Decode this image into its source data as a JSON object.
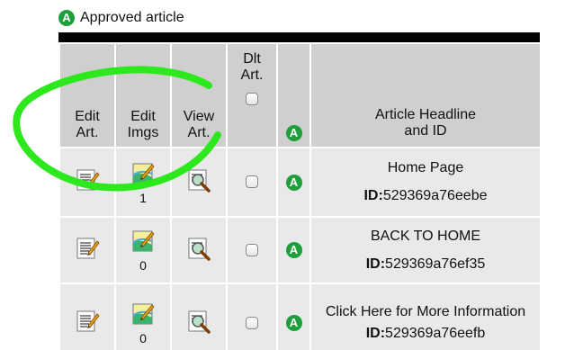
{
  "legend": {
    "badge_letter": "A",
    "label": "Approved article"
  },
  "table": {
    "headers": {
      "edit_article": "Edit\nArt.",
      "edit_images": "Edit\nImgs",
      "view_article": "View\nArt.",
      "delete_article": "Dlt\nArt.",
      "approved_badge": "A",
      "headline": "Article Headline\nand ID"
    },
    "rows": [
      {
        "image_count": "1",
        "approved_badge": "A",
        "headline": "Home Page",
        "id_label": "ID:",
        "id_value": "529369a76eebe"
      },
      {
        "image_count": "0",
        "approved_badge": "A",
        "headline": "BACK TO HOME",
        "id_label": "ID:",
        "id_value": "529369a76ef35"
      },
      {
        "image_count": "0",
        "approved_badge": "A",
        "headline": "Click Here for More Information",
        "id_label": "ID:",
        "id_value": "529369a76eefb"
      }
    ]
  },
  "icons": {
    "edit_article": "edit-document-icon",
    "edit_images": "edit-image-icon",
    "view_article": "magnifier-view-icon"
  },
  "colors": {
    "approved_badge": "#1f9e3c",
    "highlight_ring": "#2ee81e",
    "header_bg": "#cfcfcf",
    "row_bg": "#e9e9e9",
    "top_rule": "#000000"
  }
}
